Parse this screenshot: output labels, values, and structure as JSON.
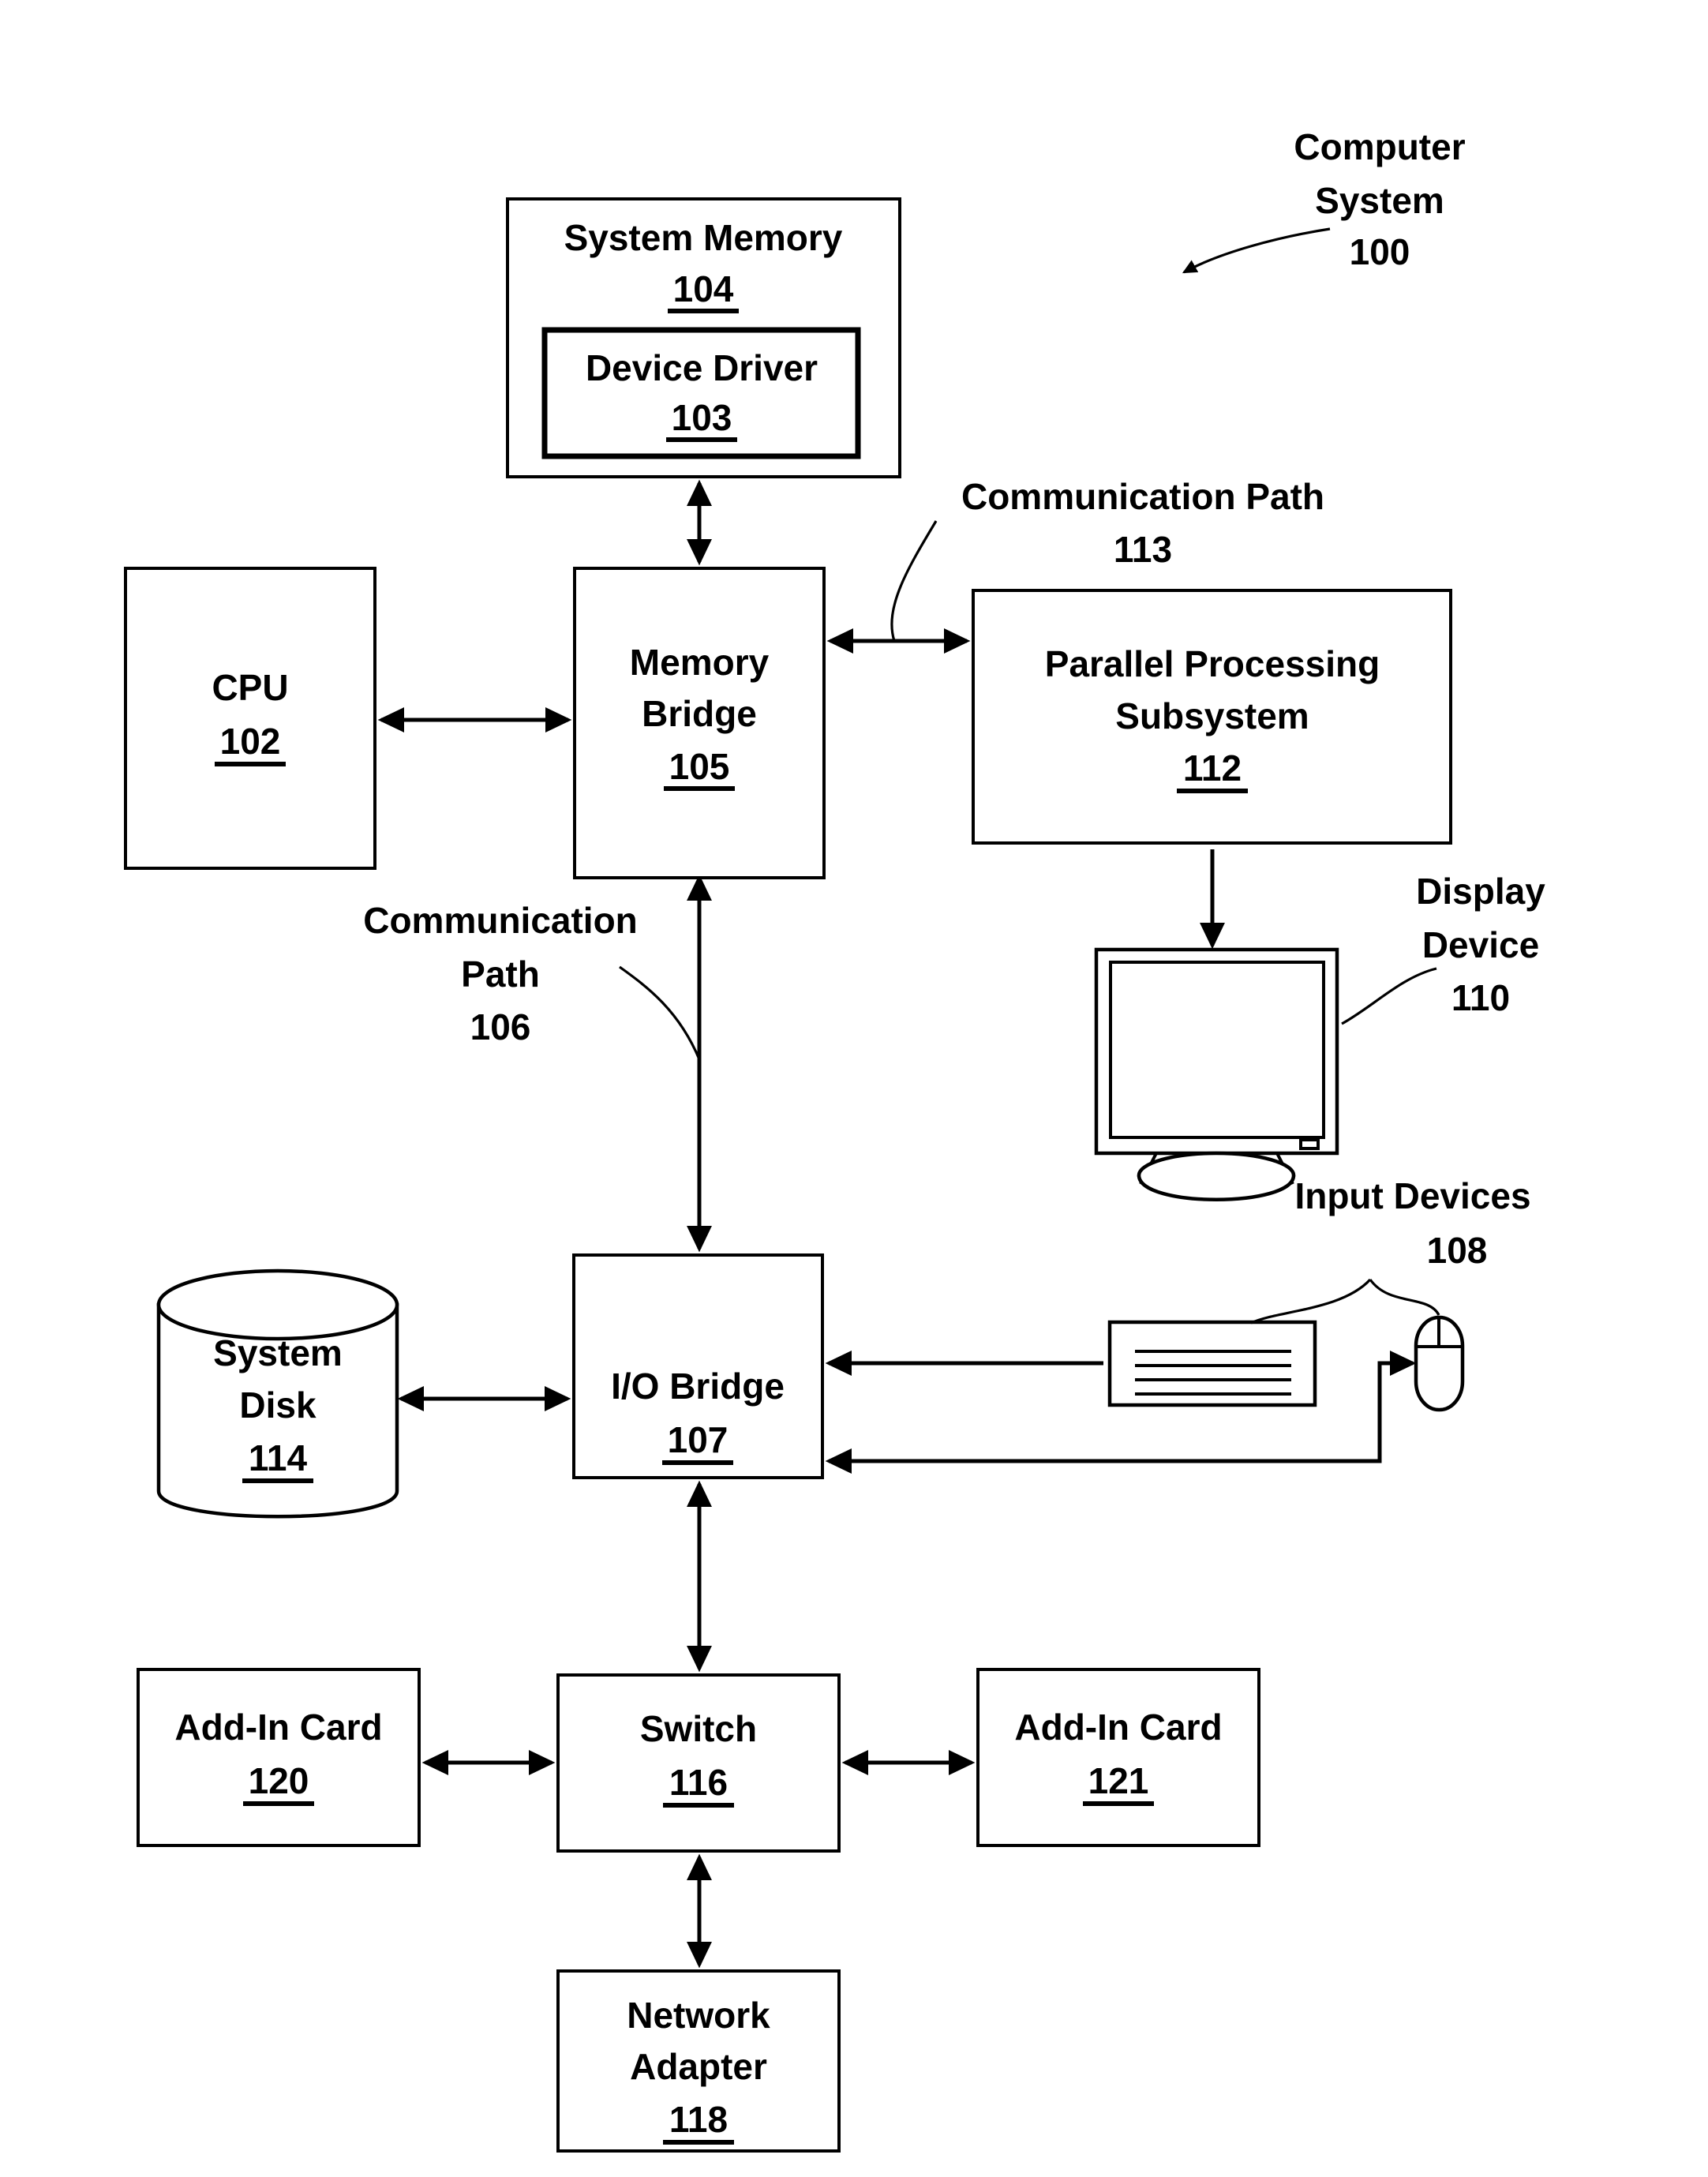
{
  "figure": {
    "title": "Computer System Block Diagram",
    "stroke_color": "#000000",
    "background_color": "#ffffff"
  },
  "annotations": {
    "computer_system": {
      "line1": "Computer",
      "line2": "System",
      "ref": "100"
    },
    "comm_path_113": {
      "line1": "Communication Path",
      "ref": "113"
    },
    "comm_path_106": {
      "line1": "Communication",
      "line2": "Path",
      "ref": "106"
    },
    "display_device": {
      "line1": "Display",
      "line2": "Device",
      "ref": "110"
    },
    "input_devices": {
      "line1": "Input Devices",
      "ref": "108"
    }
  },
  "blocks": {
    "system_memory": {
      "label": "System Memory",
      "ref": "104"
    },
    "device_driver": {
      "label": "Device Driver",
      "ref": "103"
    },
    "cpu": {
      "label": "CPU",
      "ref": "102"
    },
    "memory_bridge": {
      "line1": "Memory",
      "line2": "Bridge",
      "ref": "105"
    },
    "parallel_processing": {
      "line1": "Parallel Processing",
      "line2": "Subsystem",
      "ref": "112"
    },
    "system_disk": {
      "line1": "System",
      "line2": "Disk",
      "ref": "114"
    },
    "io_bridge": {
      "label": "I/O Bridge",
      "ref": "107"
    },
    "switch": {
      "label": "Switch",
      "ref": "116"
    },
    "add_in_card_120": {
      "label": "Add-In Card",
      "ref": "120"
    },
    "add_in_card_121": {
      "label": "Add-In Card",
      "ref": "121"
    },
    "network_adapter": {
      "line1": "Network",
      "line2": "Adapter",
      "ref": "118"
    }
  },
  "devices": {
    "display_monitor": {
      "name": "monitor-icon"
    },
    "keyboard": {
      "name": "keyboard-icon",
      "key_rows": 4
    },
    "mouse": {
      "name": "mouse-icon"
    }
  }
}
